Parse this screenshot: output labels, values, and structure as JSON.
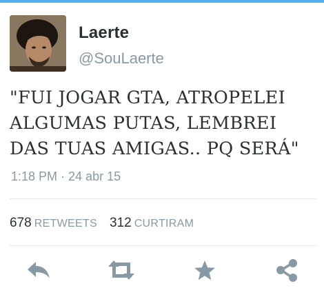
{
  "user": {
    "display_name": "Laerte",
    "handle": "@SouLaerte",
    "avatar_icon": "profile-photo"
  },
  "tweet": {
    "lines": [
      "\"FUI JOGAR GTA, ATROPELEI",
      "ALGUMAS PUTAS, LEMBREI",
      "DAS TUAS AMIGAS.. PQ SERÁ\""
    ],
    "timestamp": "1:18 PM · 24 abr 15"
  },
  "stats": {
    "retweets_count": "678",
    "retweets_label": "RETWEETS",
    "likes_count": "312",
    "likes_label": "CURTIRAM"
  },
  "actions": [
    {
      "icon": "reply-icon"
    },
    {
      "icon": "retweet-icon"
    },
    {
      "icon": "star-icon"
    },
    {
      "icon": "share-icon"
    }
  ],
  "colors": {
    "accent": "#55acee",
    "text": "#292f33",
    "muted": "#8899a6",
    "icon": "#8899a6",
    "divider": "#e1e8ed"
  }
}
